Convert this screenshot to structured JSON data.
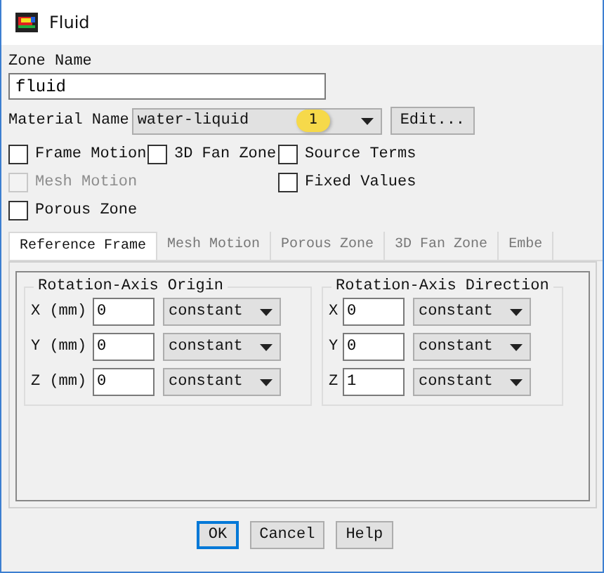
{
  "window": {
    "title": "Fluid"
  },
  "zone_name": {
    "label": "Zone Name",
    "value": "fluid"
  },
  "material": {
    "label": "Material Name",
    "value": "water-liquid",
    "edit_button": "Edit...",
    "callout": "1"
  },
  "option_columns": [
    {
      "options": [
        {
          "label": "Frame Motion",
          "checked": false,
          "disabled": false
        },
        {
          "label": "Mesh Motion",
          "checked": false,
          "disabled": true
        },
        {
          "label": "Porous Zone",
          "checked": false,
          "disabled": false
        }
      ]
    },
    {
      "options": [
        {
          "label": "3D Fan Zone",
          "checked": false,
          "disabled": false
        }
      ]
    },
    {
      "options": [
        {
          "label": "Source Terms",
          "checked": false,
          "disabled": false
        },
        {
          "label": "Fixed Values",
          "checked": false,
          "disabled": false
        }
      ]
    }
  ],
  "tabs": [
    {
      "label": "Reference Frame",
      "selected": true
    },
    {
      "label": "Mesh Motion",
      "selected": false
    },
    {
      "label": "Porous Zone",
      "selected": false
    },
    {
      "label": "3D Fan Zone",
      "selected": false
    },
    {
      "label": "Embe",
      "selected": false
    }
  ],
  "groups": [
    {
      "title": "Rotation-Axis Origin",
      "rows": [
        {
          "label": "X (mm)",
          "value": "0",
          "method": "constant"
        },
        {
          "label": "Y (mm)",
          "value": "0",
          "method": "constant"
        },
        {
          "label": "Z (mm)",
          "value": "0",
          "method": "constant"
        }
      ]
    },
    {
      "title": "Rotation-Axis Direction",
      "rows": [
        {
          "label": "X",
          "value": "0",
          "method": "constant"
        },
        {
          "label": "Y",
          "value": "0",
          "method": "constant"
        },
        {
          "label": "Z",
          "value": "1",
          "method": "constant"
        }
      ]
    }
  ],
  "buttons": [
    {
      "label": "OK",
      "selected": true
    },
    {
      "label": "Cancel",
      "selected": false
    },
    {
      "label": "Help",
      "selected": false
    }
  ]
}
